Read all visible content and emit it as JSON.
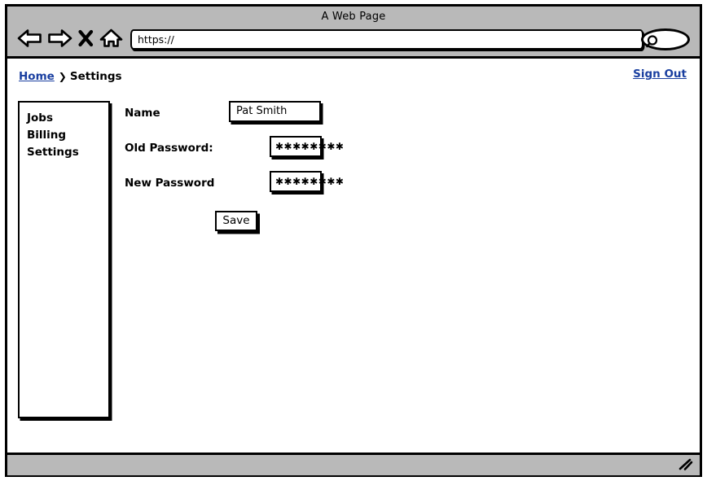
{
  "window": {
    "title": "A Web Page"
  },
  "toolbar": {
    "back_icon": "back-arrow-icon",
    "forward_icon": "forward-arrow-icon",
    "stop_icon": "close-x-icon",
    "home_icon": "home-icon",
    "url_value": "https://",
    "url_placeholder": "https://",
    "search_icon": "magnifier-icon"
  },
  "breadcrumb": {
    "home_label": "Home",
    "separator": "❯",
    "current_label": "Settings"
  },
  "header": {
    "signout_label": "Sign Out"
  },
  "sidebar": {
    "items": [
      {
        "label": "Jobs"
      },
      {
        "label": "Billing"
      },
      {
        "label": "Settings"
      }
    ]
  },
  "form": {
    "rows": [
      {
        "label": "Name",
        "value": "Pat Smith",
        "placeholder": "Name"
      },
      {
        "label": "Old Password:",
        "value": "✱✱✱✱✱✱✱✱",
        "placeholder": "Old Password"
      },
      {
        "label": "New Password",
        "value": "✱✱✱✱✱✱✱✱",
        "placeholder": "New Password"
      }
    ],
    "save_label": "Save"
  },
  "statusbar": {
    "resize_icon": "resize-grip-icon"
  },
  "colors": {
    "chrome_gray": "#b9b9b9",
    "link_blue": "#1a3fa0",
    "ink": "#000000",
    "paper": "#ffffff"
  }
}
